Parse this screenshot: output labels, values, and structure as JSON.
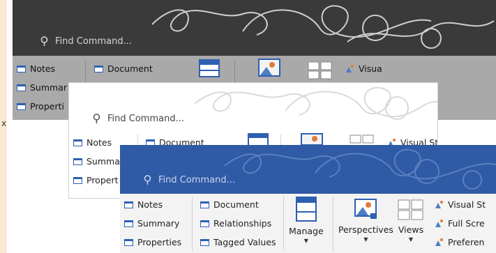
{
  "find_command": {
    "placeholder": "Find Command..."
  },
  "edge_text": "x",
  "panel_dark": {
    "col1": [
      "Notes",
      "Summar",
      "Properti"
    ],
    "col2": [
      "Document"
    ],
    "right_label": "Visua"
  },
  "panel_light": {
    "col1": [
      "Notes",
      "Summa",
      "Propert"
    ],
    "col2": [
      "Document"
    ],
    "right_label": "Visual St"
  },
  "panel_blue": {
    "col1": [
      "Notes",
      "Summary",
      "Properties"
    ],
    "col2": [
      "Document",
      "Relationships",
      "Tagged Values"
    ],
    "manage_label": "Manage",
    "perspectives_label": "Perspectives",
    "views_label": "Views",
    "right_items": [
      "Visual St",
      "Full Scre",
      "Preferen"
    ]
  },
  "colors": {
    "dark_ribbon": "#3a3a3a",
    "light_ribbon": "#ffffff",
    "blue_ribbon": "#2f5aa6",
    "accent_icon": "#2e5fb0"
  },
  "icons": [
    "search-icon",
    "window-icon",
    "manage-icon",
    "perspectives-icon",
    "views-icon",
    "visual-style-icon",
    "full-screen-icon",
    "preferences-icon"
  ]
}
